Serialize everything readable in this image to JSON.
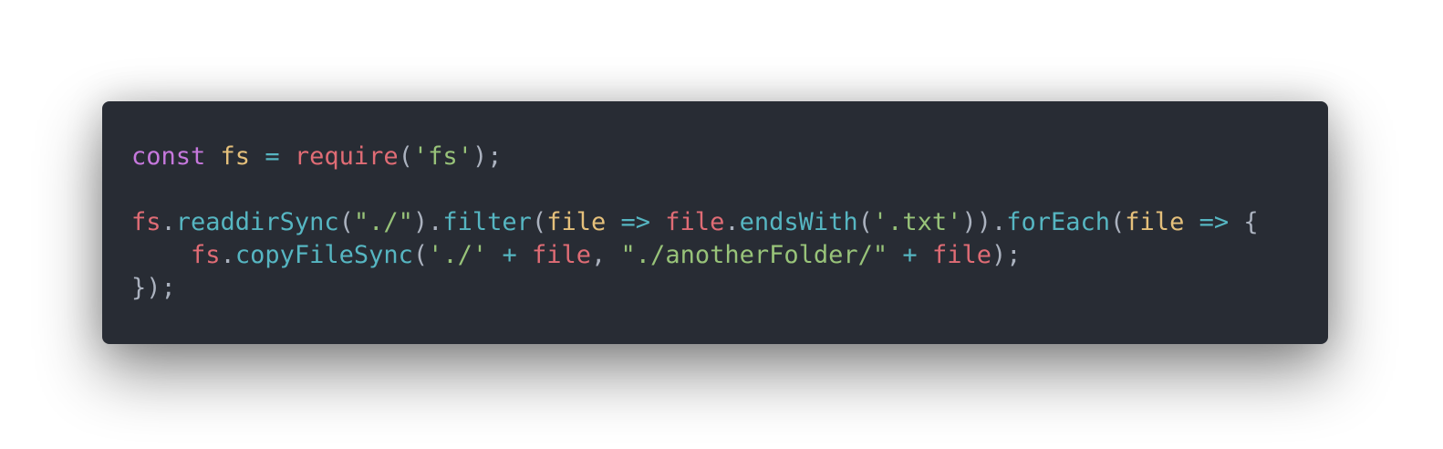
{
  "colors": {
    "background": "#ffffff",
    "editor_background": "#282c34",
    "keyword": "#c678dd",
    "variable": "#e5c07b",
    "operator": "#56b6c2",
    "function": "#e06c75",
    "punctuation": "#abb2bf",
    "string": "#98c379",
    "method": "#56b6c2",
    "parameter": "#e5c07b",
    "identifier": "#e06c75"
  },
  "code": {
    "lines": [
      [
        {
          "t": "keyword",
          "v": "const"
        },
        {
          "t": "text",
          "v": " "
        },
        {
          "t": "var",
          "v": "fs"
        },
        {
          "t": "text",
          "v": " "
        },
        {
          "t": "op",
          "v": "="
        },
        {
          "t": "text",
          "v": " "
        },
        {
          "t": "func",
          "v": "require"
        },
        {
          "t": "punct",
          "v": "("
        },
        {
          "t": "string",
          "v": "'fs'"
        },
        {
          "t": "punct",
          "v": ");"
        }
      ],
      [],
      [
        {
          "t": "ident",
          "v": "fs"
        },
        {
          "t": "punct",
          "v": "."
        },
        {
          "t": "method",
          "v": "readdirSync"
        },
        {
          "t": "punct",
          "v": "("
        },
        {
          "t": "string",
          "v": "\"./\""
        },
        {
          "t": "punct",
          "v": ")."
        },
        {
          "t": "method",
          "v": "filter"
        },
        {
          "t": "punct",
          "v": "("
        },
        {
          "t": "param",
          "v": "file"
        },
        {
          "t": "text",
          "v": " "
        },
        {
          "t": "op",
          "v": "=>"
        },
        {
          "t": "text",
          "v": " "
        },
        {
          "t": "ident",
          "v": "file"
        },
        {
          "t": "punct",
          "v": "."
        },
        {
          "t": "method",
          "v": "endsWith"
        },
        {
          "t": "punct",
          "v": "("
        },
        {
          "t": "string",
          "v": "'.txt'"
        },
        {
          "t": "punct",
          "v": "))."
        },
        {
          "t": "method",
          "v": "forEach"
        },
        {
          "t": "punct",
          "v": "("
        },
        {
          "t": "param",
          "v": "file"
        },
        {
          "t": "text",
          "v": " "
        },
        {
          "t": "op",
          "v": "=>"
        },
        {
          "t": "text",
          "v": " "
        },
        {
          "t": "punct",
          "v": "{"
        }
      ],
      [
        {
          "t": "text",
          "v": "    "
        },
        {
          "t": "ident",
          "v": "fs"
        },
        {
          "t": "punct",
          "v": "."
        },
        {
          "t": "method",
          "v": "copyFileSync"
        },
        {
          "t": "punct",
          "v": "("
        },
        {
          "t": "string",
          "v": "'./'"
        },
        {
          "t": "text",
          "v": " "
        },
        {
          "t": "op",
          "v": "+"
        },
        {
          "t": "text",
          "v": " "
        },
        {
          "t": "ident",
          "v": "file"
        },
        {
          "t": "punct",
          "v": ","
        },
        {
          "t": "text",
          "v": " "
        },
        {
          "t": "string",
          "v": "\"./anotherFolder/\""
        },
        {
          "t": "text",
          "v": " "
        },
        {
          "t": "op",
          "v": "+"
        },
        {
          "t": "text",
          "v": " "
        },
        {
          "t": "ident",
          "v": "file"
        },
        {
          "t": "punct",
          "v": ");"
        }
      ],
      [
        {
          "t": "punct",
          "v": "});"
        }
      ]
    ]
  }
}
